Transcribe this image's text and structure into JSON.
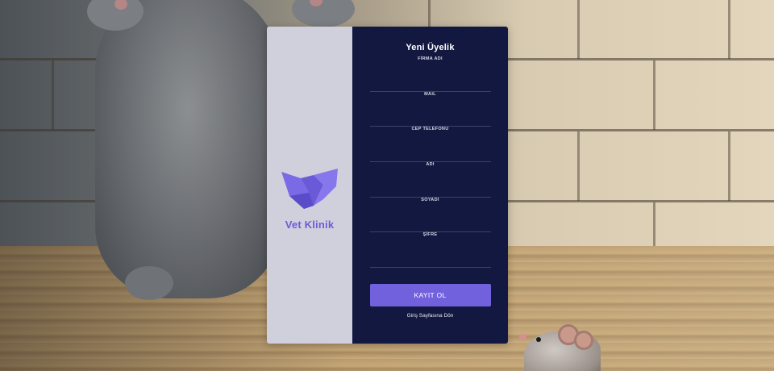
{
  "brand": {
    "name": "Vet Klinik",
    "accent_color": "#6a5cdc",
    "logo_icon": "v-logo-icon"
  },
  "form": {
    "title": "Yeni Üyelik",
    "fields": [
      {
        "label": "FİRMA ADI",
        "value": ""
      },
      {
        "label": "MAIL",
        "value": ""
      },
      {
        "label": "CEP TELEFONU",
        "value": ""
      },
      {
        "label": "ADI",
        "value": ""
      },
      {
        "label": "SOYADI",
        "value": ""
      },
      {
        "label": "ŞİFRE",
        "value": ""
      }
    ],
    "submit_label": "KAYIT OL",
    "back_link": "Giriş Sayfasına Dön",
    "panel_color": "#131840",
    "button_color": "#7161dc"
  }
}
